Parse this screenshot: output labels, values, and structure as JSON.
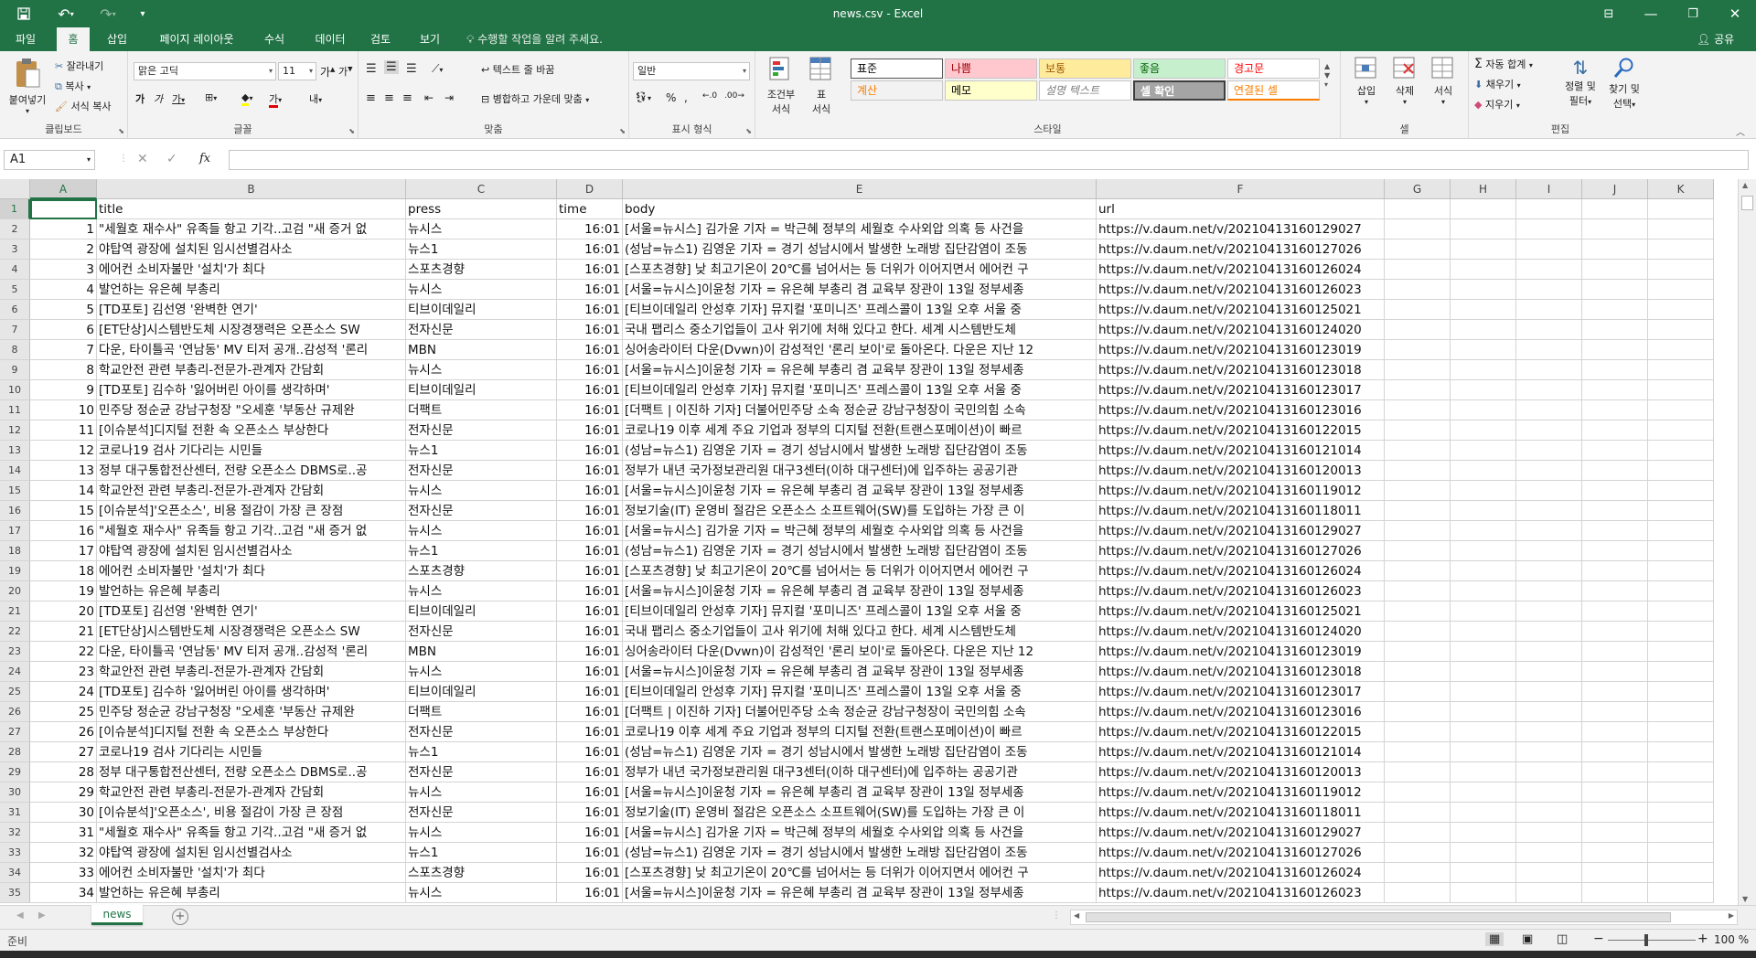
{
  "titlebar": {
    "title": "news.csv - Excel",
    "save_icon": "save-icon",
    "undo_icon": "undo-icon",
    "redo_icon": "redo-icon",
    "customize_icon": "chevron-down-icon"
  },
  "menu": {
    "tabs": [
      "파일",
      "홈",
      "삽입",
      "페이지 레이아웃",
      "수식",
      "데이터",
      "검토",
      "보기"
    ],
    "active_tab": "홈",
    "tell_me": "수행할 작업을 알려 주세요.",
    "share": "공유"
  },
  "ribbon": {
    "clipboard": {
      "label": "클립보드",
      "paste": "붙여넣기",
      "cut": "잘라내기",
      "copy": "복사",
      "format_painter": "서식 복사"
    },
    "font": {
      "label": "글꼴",
      "font_name": "맑은 고딕",
      "font_size": "11"
    },
    "alignment": {
      "label": "맞춤",
      "wrap_text": "텍스트 줄 바꿈",
      "merge_center": "병합하고 가운데 맞춤"
    },
    "number": {
      "label": "표시 형식",
      "format": "일반"
    },
    "styles": {
      "label": "스타일",
      "conditional": [
        "조건부",
        "서식"
      ],
      "as_table": [
        "표",
        "서식"
      ],
      "cells": [
        {
          "text": "표준",
          "bg": "#ffffff",
          "fg": "#000000"
        },
        {
          "text": "나쁨",
          "bg": "#ffc7ce",
          "fg": "#9c0006"
        },
        {
          "text": "보통",
          "bg": "#ffeb9c",
          "fg": "#9c5700"
        },
        {
          "text": "좋음",
          "bg": "#c6efce",
          "fg": "#006100"
        },
        {
          "text": "경고문",
          "bg": "#ffffff",
          "fg": "#ff0000"
        },
        {
          "text": "계산",
          "bg": "#f2f2f2",
          "fg": "#fa7d00"
        },
        {
          "text": "메모",
          "bg": "#ffffcc",
          "fg": "#000000"
        },
        {
          "text": "설명 텍스트",
          "bg": "#ffffff",
          "fg": "#7f7f7f"
        },
        {
          "text": "셀 확인",
          "bg": "#a5a5a5",
          "fg": "#ffffff"
        },
        {
          "text": "연결된 셀",
          "bg": "#ffffff",
          "fg": "#fa7d00"
        }
      ]
    },
    "cells": {
      "label": "셀",
      "insert": "삽입",
      "delete": "삭제",
      "format": "서식"
    },
    "editing": {
      "label": "편집",
      "autosum": "자동 합계",
      "fill": "채우기",
      "clear": "지우기",
      "sort": [
        "정렬 및",
        "필터"
      ],
      "find": [
        "찾기 및",
        "선택"
      ]
    }
  },
  "formula_bar": {
    "name_box": "A1",
    "cancel_icon": "close-icon",
    "enter_icon": "check-icon",
    "fx": "fx",
    "content": ""
  },
  "grid": {
    "columns": [
      "A",
      "B",
      "C",
      "D",
      "E",
      "F",
      "G",
      "H",
      "I",
      "J",
      "K"
    ],
    "header": [
      "",
      "title",
      "press",
      "time",
      "body",
      "url"
    ],
    "rows": [
      [
        "1",
        "\"세월호 재수사\" 유족들 항고 기각..고검 \"새 증거 없",
        "뉴시스",
        "16:01",
        "[서울=뉴시스] 김가윤 기자 = 박근혜 정부의 세월호 수사외압 의혹 등 사건을",
        "https://v.daum.net/v/20210413160129027"
      ],
      [
        "2",
        "야탑역 광장에 설치된 임시선별검사소",
        "뉴스1",
        "16:01",
        "(성남=뉴스1) 김영운 기자 = 경기 성남시에서 발생한 노래방 집단감염이 조동",
        "https://v.daum.net/v/20210413160127026"
      ],
      [
        "3",
        "에어컨 소비자불만 '설치'가 최다",
        "스포츠경향",
        "16:01",
        "[스포츠경향] 낮 최고기온이 20℃를 넘어서는 등 더위가 이어지면서 에어컨 구",
        "https://v.daum.net/v/20210413160126024"
      ],
      [
        "4",
        "발언하는 유은혜 부총리",
        "뉴시스",
        "16:01",
        "[서울=뉴시스]이윤청 기자 = 유은혜 부총리 겸 교육부 장관이 13일 정부세종",
        "https://v.daum.net/v/20210413160126023"
      ],
      [
        "5",
        "[TD포토] 김선영 '완벽한 연기'",
        "티브이데일리",
        "16:01",
        "[티브이데일리 안성후 기자] 뮤지컬 '포미니즈' 프레스콜이 13일 오후 서울 중",
        "https://v.daum.net/v/20210413160125021"
      ],
      [
        "6",
        "[ET단상]시스템반도체 시장경쟁력은 오픈소스 SW",
        "전자신문",
        "16:01",
        "국내 팹리스 중소기업들이 고사 위기에 처해 있다고 한다. 세계 시스템반도체",
        "https://v.daum.net/v/20210413160124020"
      ],
      [
        "7",
        "다운, 타이틀곡 '연남동' MV 티저 공개..감성적 '론리",
        "MBN",
        "16:01",
        "싱어송라이터 다운(Dvwn)이 감성적인 '론리 보이'로 돌아온다. 다운은 지난 12",
        "https://v.daum.net/v/20210413160123019"
      ],
      [
        "8",
        "학교안전 관련 부총리-전문가-관계자 간담회",
        "뉴시스",
        "16:01",
        "[서울=뉴시스]이윤청 기자 = 유은혜 부총리 겸 교육부 장관이 13일 정부세종",
        "https://v.daum.net/v/20210413160123018"
      ],
      [
        "9",
        "[TD포토] 김수하 '잃어버린 아이를 생각하며'",
        "티브이데일리",
        "16:01",
        "[티브이데일리 안성후 기자] 뮤지컬 '포미니즈' 프레스콜이 13일 오후 서울 중",
        "https://v.daum.net/v/20210413160123017"
      ],
      [
        "10",
        "민주당 정순균 강남구청장 \"오세훈 '부동산 규제완",
        "더팩트",
        "16:01",
        "[더팩트 | 이진하 기자] 더불어민주당 소속 정순균 강남구청장이 국민의힘 소속",
        "https://v.daum.net/v/20210413160123016"
      ],
      [
        "11",
        "[이슈분석]디지털 전환 속 오픈소스 부상한다",
        "전자신문",
        "16:01",
        "코로나19 이후 세계 주요 기업과 정부의 디지털 전환(트랜스포메이션)이 빠르",
        "https://v.daum.net/v/20210413160122015"
      ],
      [
        "12",
        "코로나19 검사 기다리는 시민들",
        "뉴스1",
        "16:01",
        "(성남=뉴스1) 김영운 기자 = 경기 성남시에서 발생한 노래방 집단감염이 조동",
        "https://v.daum.net/v/20210413160121014"
      ],
      [
        "13",
        "정부 대구통합전산센터, 전량 오픈소스 DBMS로..공",
        "전자신문",
        "16:01",
        "정부가 내년 국가정보관리원 대구3센터(이하 대구센터)에 입주하는 공공기관",
        "https://v.daum.net/v/20210413160120013"
      ],
      [
        "14",
        "학교안전 관련 부총리-전문가-관계자 간담회",
        "뉴시스",
        "16:01",
        "[서울=뉴시스]이윤청 기자 = 유은혜 부총리 겸 교육부 장관이 13일 정부세종",
        "https://v.daum.net/v/20210413160119012"
      ],
      [
        "15",
        "[이슈분석]'오픈소스', 비용 절감이 가장 큰 장점",
        "전자신문",
        "16:01",
        "정보기술(IT) 운영비 절감은 오픈소스 소프트웨어(SW)를 도입하는 가장 큰 이",
        "https://v.daum.net/v/20210413160118011"
      ],
      [
        "16",
        "\"세월호 재수사\" 유족들 항고 기각..고검 \"새 증거 없",
        "뉴시스",
        "16:01",
        "[서울=뉴시스] 김가윤 기자 = 박근혜 정부의 세월호 수사외압 의혹 등 사건을",
        "https://v.daum.net/v/20210413160129027"
      ],
      [
        "17",
        "야탑역 광장에 설치된 임시선별검사소",
        "뉴스1",
        "16:01",
        "(성남=뉴스1) 김영운 기자 = 경기 성남시에서 발생한 노래방 집단감염이 조동",
        "https://v.daum.net/v/20210413160127026"
      ],
      [
        "18",
        "에어컨 소비자불만 '설치'가 최다",
        "스포츠경향",
        "16:01",
        "[스포츠경향] 낮 최고기온이 20℃를 넘어서는 등 더위가 이어지면서 에어컨 구",
        "https://v.daum.net/v/20210413160126024"
      ],
      [
        "19",
        "발언하는 유은혜 부총리",
        "뉴시스",
        "16:01",
        "[서울=뉴시스]이윤청 기자 = 유은혜 부총리 겸 교육부 장관이 13일 정부세종",
        "https://v.daum.net/v/20210413160126023"
      ],
      [
        "20",
        "[TD포토] 김선영 '완벽한 연기'",
        "티브이데일리",
        "16:01",
        "[티브이데일리 안성후 기자] 뮤지컬 '포미니즈' 프레스콜이 13일 오후 서울 중",
        "https://v.daum.net/v/20210413160125021"
      ],
      [
        "21",
        "[ET단상]시스템반도체 시장경쟁력은 오픈소스 SW",
        "전자신문",
        "16:01",
        "국내 팹리스 중소기업들이 고사 위기에 처해 있다고 한다. 세계 시스템반도체",
        "https://v.daum.net/v/20210413160124020"
      ],
      [
        "22",
        "다운, 타이틀곡 '연남동' MV 티저 공개..감성적 '론리",
        "MBN",
        "16:01",
        "싱어송라이터 다운(Dvwn)이 감성적인 '론리 보이'로 돌아온다. 다운은 지난 12",
        "https://v.daum.net/v/20210413160123019"
      ],
      [
        "23",
        "학교안전 관련 부총리-전문가-관계자 간담회",
        "뉴시스",
        "16:01",
        "[서울=뉴시스]이윤청 기자 = 유은혜 부총리 겸 교육부 장관이 13일 정부세종",
        "https://v.daum.net/v/20210413160123018"
      ],
      [
        "24",
        "[TD포토] 김수하 '잃어버린 아이를 생각하며'",
        "티브이데일리",
        "16:01",
        "[티브이데일리 안성후 기자] 뮤지컬 '포미니즈' 프레스콜이 13일 오후 서울 중",
        "https://v.daum.net/v/20210413160123017"
      ],
      [
        "25",
        "민주당 정순균 강남구청장 \"오세훈 '부동산 규제완",
        "더팩트",
        "16:01",
        "[더팩트 | 이진하 기자] 더불어민주당 소속 정순균 강남구청장이 국민의힘 소속",
        "https://v.daum.net/v/20210413160123016"
      ],
      [
        "26",
        "[이슈분석]디지털 전환 속 오픈소스 부상한다",
        "전자신문",
        "16:01",
        "코로나19 이후 세계 주요 기업과 정부의 디지털 전환(트랜스포메이션)이 빠르",
        "https://v.daum.net/v/20210413160122015"
      ],
      [
        "27",
        "코로나19 검사 기다리는 시민들",
        "뉴스1",
        "16:01",
        "(성남=뉴스1) 김영운 기자 = 경기 성남시에서 발생한 노래방 집단감염이 조동",
        "https://v.daum.net/v/20210413160121014"
      ],
      [
        "28",
        "정부 대구통합전산센터, 전량 오픈소스 DBMS로..공",
        "전자신문",
        "16:01",
        "정부가 내년 국가정보관리원 대구3센터(이하 대구센터)에 입주하는 공공기관",
        "https://v.daum.net/v/20210413160120013"
      ],
      [
        "29",
        "학교안전 관련 부총리-전문가-관계자 간담회",
        "뉴시스",
        "16:01",
        "[서울=뉴시스]이윤청 기자 = 유은혜 부총리 겸 교육부 장관이 13일 정부세종",
        "https://v.daum.net/v/20210413160119012"
      ],
      [
        "30",
        "[이슈분석]'오픈소스', 비용 절감이 가장 큰 장점",
        "전자신문",
        "16:01",
        "정보기술(IT) 운영비 절감은 오픈소스 소프트웨어(SW)를 도입하는 가장 큰 이",
        "https://v.daum.net/v/20210413160118011"
      ],
      [
        "31",
        "\"세월호 재수사\" 유족들 항고 기각..고검 \"새 증거 없",
        "뉴시스",
        "16:01",
        "[서울=뉴시스] 김가윤 기자 = 박근혜 정부의 세월호 수사외압 의혹 등 사건을",
        "https://v.daum.net/v/20210413160129027"
      ],
      [
        "32",
        "야탑역 광장에 설치된 임시선별검사소",
        "뉴스1",
        "16:01",
        "(성남=뉴스1) 김영운 기자 = 경기 성남시에서 발생한 노래방 집단감염이 조동",
        "https://v.daum.net/v/20210413160127026"
      ],
      [
        "33",
        "에어컨 소비자불만 '설치'가 최다",
        "스포츠경향",
        "16:01",
        "[스포츠경향] 낮 최고기온이 20℃를 넘어서는 등 더위가 이어지면서 에어컨 구",
        "https://v.daum.net/v/20210413160126024"
      ],
      [
        "34",
        "발언하는 유은혜 부총리",
        "뉴시스",
        "16:01",
        "[서울=뉴시스]이윤청 기자 = 유은혜 부총리 겸 교육부 장관이 13일 정부세종",
        "https://v.daum.net/v/20210413160126023"
      ]
    ]
  },
  "sheets": {
    "tabs": [
      "news"
    ],
    "active": "news",
    "add_icon": "plus-icon"
  },
  "status": {
    "mode": "준비",
    "zoom": "100 %"
  }
}
